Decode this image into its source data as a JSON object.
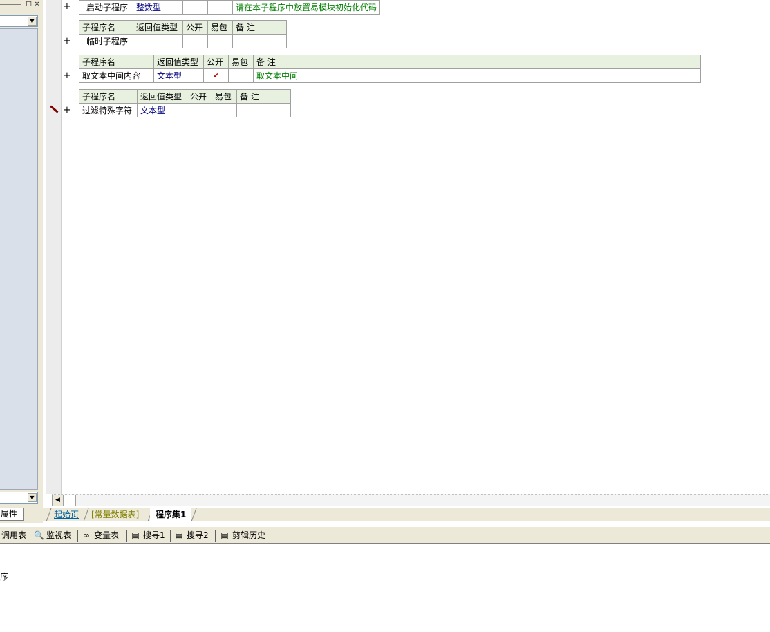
{
  "left_panel": {
    "titlebar_buttons": [
      "□",
      "×"
    ],
    "combo_arrow": "▼",
    "tab_label": "属性"
  },
  "subroutines": [
    {
      "headers": null,
      "row": {
        "name": "_启动子程序",
        "return_type": "整数型",
        "public": "",
        "easy_pack": "",
        "remark": "请在本子程序中放置易模块初始化代码"
      }
    },
    {
      "headers": {
        "name": "子程序名",
        "return_type": "返回值类型",
        "public": "公开",
        "easy_pack": "易包",
        "remark": "备 注"
      },
      "row": {
        "name": "_临时子程序",
        "return_type": "",
        "public": "",
        "easy_pack": "",
        "remark": ""
      }
    },
    {
      "headers": {
        "name": "子程序名",
        "return_type": "返回值类型",
        "public": "公开",
        "easy_pack": "易包",
        "remark": "备 注"
      },
      "row": {
        "name": "取文本中间内容",
        "return_type": "文本型",
        "public": "✔",
        "easy_pack": "",
        "remark": "取文本中间"
      }
    },
    {
      "headers": {
        "name": "子程序名",
        "return_type": "返回值类型",
        "public": "公开",
        "easy_pack": "易包",
        "remark": "备 注"
      },
      "row": {
        "name": "过滤特殊字符",
        "return_type": "文本型",
        "public": "",
        "easy_pack": "",
        "remark": ""
      }
    }
  ],
  "expand_symbol": "+",
  "doc_tabs": [
    "起始页",
    "[常量数据表]",
    "程序集1"
  ],
  "bottom_toolbar": {
    "items": [
      {
        "label": "调用表",
        "icon": ""
      },
      {
        "label": "监视表",
        "icon": "🔍"
      },
      {
        "label": "变量表",
        "icon": "∞"
      },
      {
        "label": "搜寻1",
        "icon": "▤"
      },
      {
        "label": "搜寻2",
        "icon": "▤"
      },
      {
        "label": "剪辑历史",
        "icon": "▤"
      }
    ]
  },
  "output": {
    "text": "序"
  },
  "scroll": {
    "left_arrow": "◀"
  }
}
